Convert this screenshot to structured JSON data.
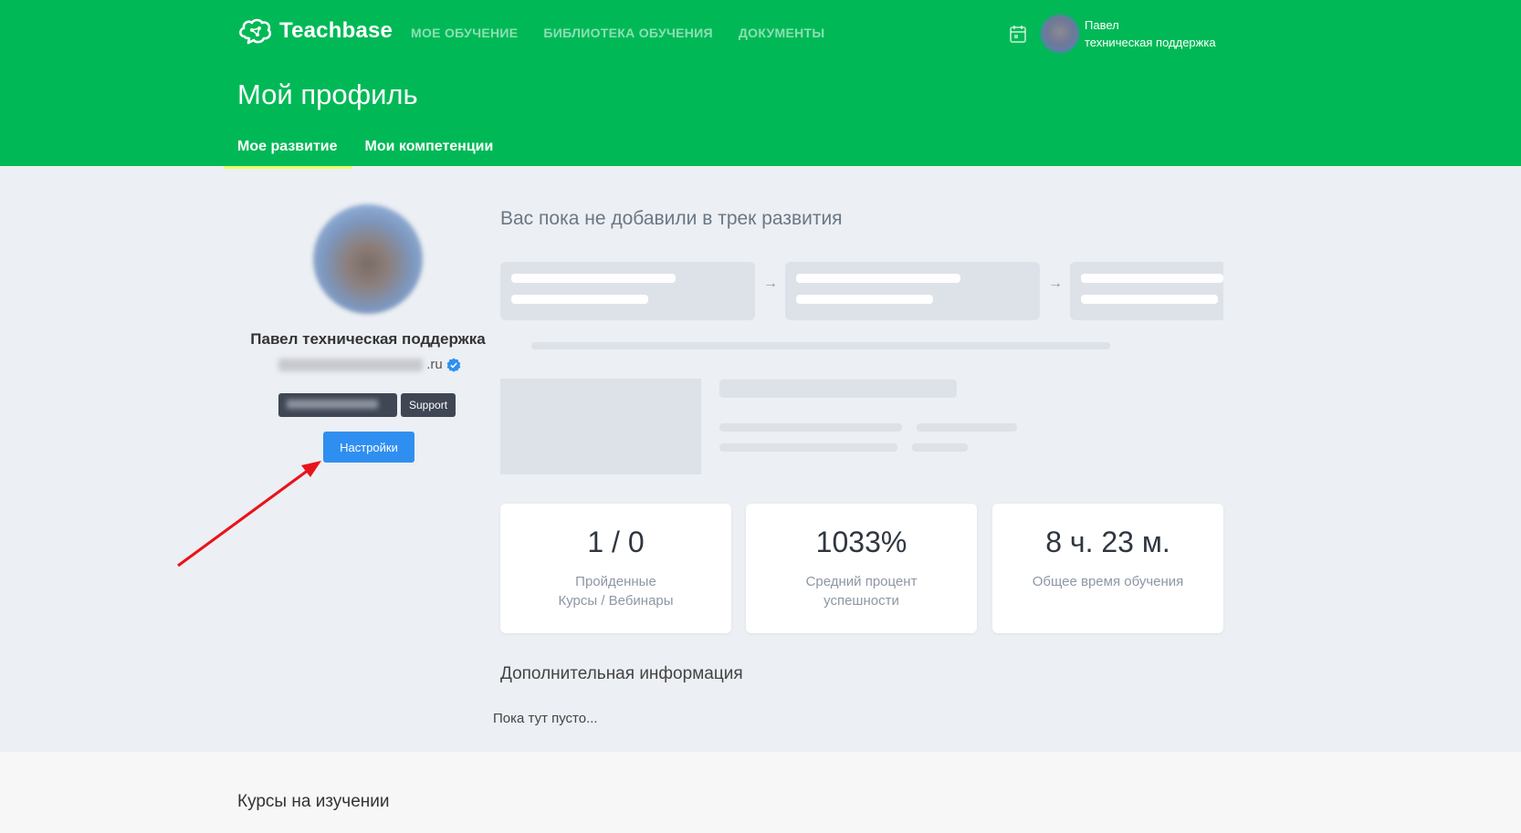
{
  "header": {
    "brand": "Teachbase",
    "nav": [
      "МОЕ ОБУЧЕНИЕ",
      "БИБЛИОТЕКА ОБУЧЕНИЯ",
      "ДОКУМЕНТЫ"
    ],
    "user_name_line1": "Павел",
    "user_name_line2": "техническая поддержка",
    "icons": [
      "brain-logo-icon",
      "calendar-icon"
    ]
  },
  "page": {
    "title": "Мой профиль",
    "tabs": [
      "Мое развитие",
      "Мои компетенции"
    ],
    "active_tab": 0
  },
  "profile": {
    "name": "Павел техническая поддержка",
    "email_suffix": ".ru",
    "badge": "Support",
    "settings_label": "Настройки"
  },
  "track": {
    "empty_message": "Вас пока не добавили в трек развития"
  },
  "stats": [
    {
      "value": "1 / 0",
      "label1": "Пройденные",
      "label2": "Курсы / Вебинары"
    },
    {
      "value": "1033%",
      "label1": "Средний процент",
      "label2": "успешности"
    },
    {
      "value": "8 ч. 23 м.",
      "label1": "Общее время обучения",
      "label2": ""
    }
  ],
  "extra": {
    "title": "Дополнительная информация",
    "empty": "Пока тут пусто..."
  },
  "courses": {
    "title": "Курсы на изучении"
  },
  "colors": {
    "header_green": "#00b956",
    "tab_underline": "#e5ff6a",
    "button_blue": "#2f8ff0",
    "annotation_red": "#e8141b"
  }
}
